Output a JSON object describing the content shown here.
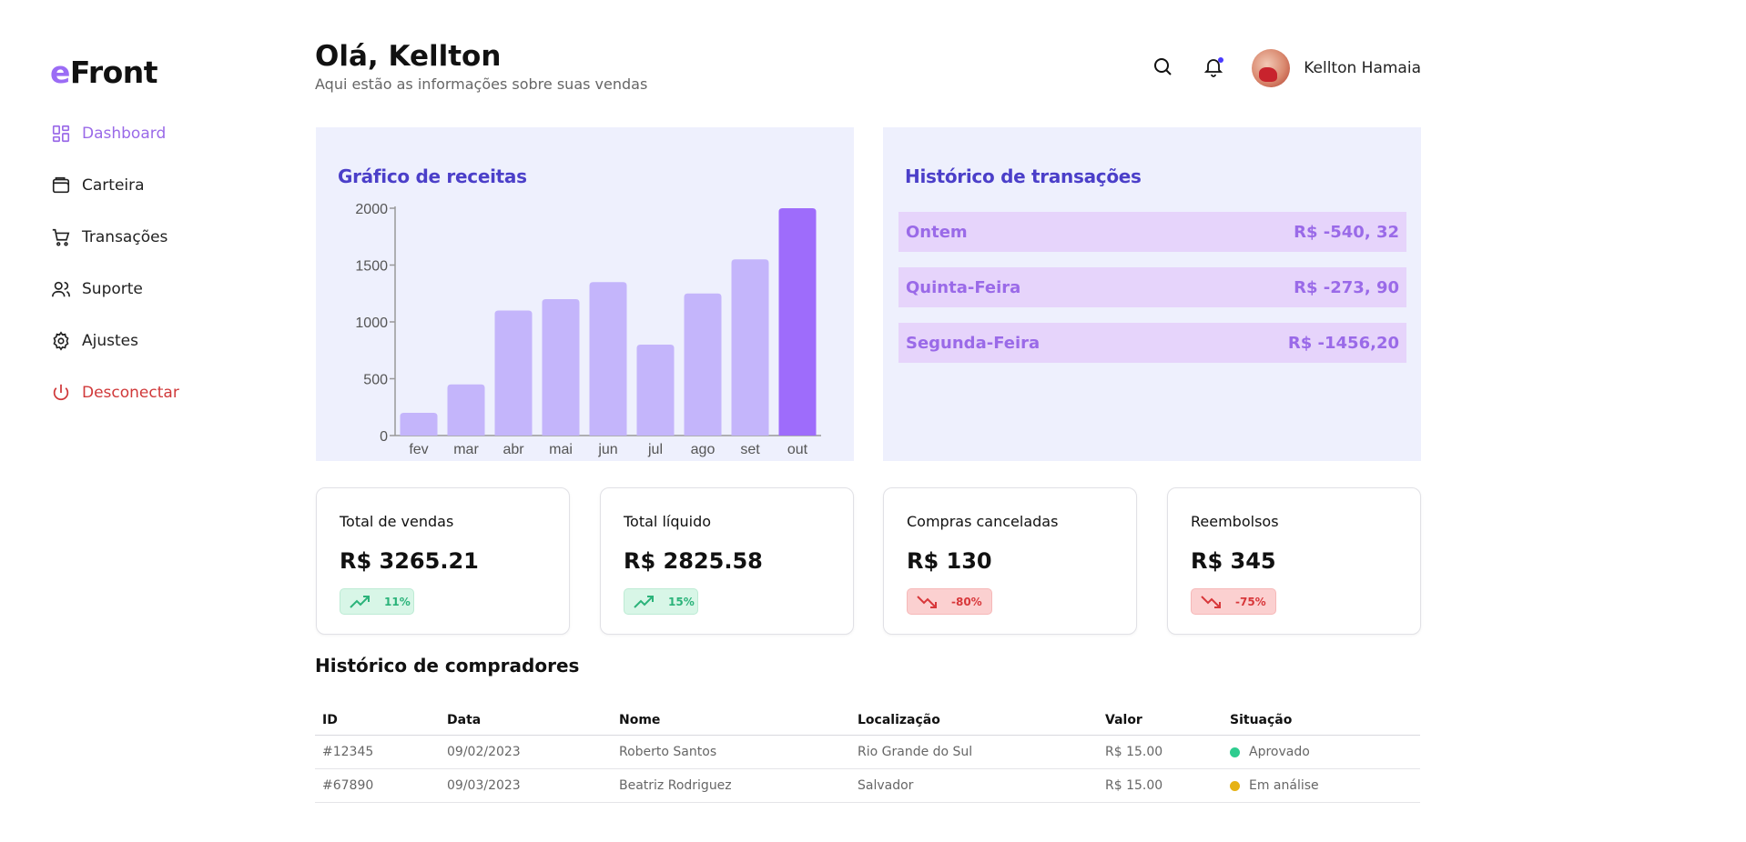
{
  "brand": {
    "prefix": "e",
    "name": "Front",
    "accent_color": "#9b6cf5"
  },
  "sidebar": {
    "items": [
      {
        "label": "Dashboard",
        "icon": "dashboard-icon",
        "state": "active"
      },
      {
        "label": "Carteira",
        "icon": "wallet-icon",
        "state": "normal"
      },
      {
        "label": "Transações",
        "icon": "cart-icon",
        "state": "normal"
      },
      {
        "label": "Suporte",
        "icon": "users-icon",
        "state": "normal"
      },
      {
        "label": "Ajustes",
        "icon": "gear-icon",
        "state": "normal"
      },
      {
        "label": "Desconectar",
        "icon": "power-icon",
        "state": "danger"
      }
    ]
  },
  "header": {
    "greeting": "Olá, Kellton",
    "subtitle": "Aqui estão as informações sobre suas vendas",
    "user_name": "Kellton Hamaia"
  },
  "revenue_panel": {
    "title": "Gráfico de receitas"
  },
  "chart_data": {
    "type": "bar",
    "categories": [
      "fev",
      "mar",
      "abr",
      "mai",
      "jun",
      "jul",
      "ago",
      "set",
      "out"
    ],
    "values": [
      200,
      450,
      1100,
      1200,
      1350,
      800,
      1250,
      1550,
      2000
    ],
    "highlight_index": 8,
    "bar_color": "#c4b5fb",
    "highlight_color": "#9e6cfb",
    "ylim": [
      0,
      2000
    ],
    "yticks": [
      "0",
      "500",
      "1000",
      "1500",
      "2000"
    ],
    "title": "Gráfico de receitas",
    "xlabel": "",
    "ylabel": "",
    "grid": false
  },
  "transactions": {
    "title": "Histórico de transações",
    "rows": [
      {
        "label": "Ontem",
        "amount": "R$ -540, 32"
      },
      {
        "label": "Quinta-Feira",
        "amount": "R$ -273, 90"
      },
      {
        "label": "Segunda-Feira",
        "amount": "R$ -1456,20"
      }
    ]
  },
  "cards": [
    {
      "title": "Total de vendas",
      "value": "R$ 3265.21",
      "change": "11%",
      "trend": "up"
    },
    {
      "title": "Total líquido",
      "value": "R$ 2825.58",
      "change": "15%",
      "trend": "up"
    },
    {
      "title": "Compras canceladas",
      "value": "R$ 130",
      "change": "-80%",
      "trend": "down"
    },
    {
      "title": "Reembolsos",
      "value": "R$ 345",
      "change": "-75%",
      "trend": "down"
    }
  ],
  "buyers": {
    "title": "Histórico de compradores",
    "columns": [
      "ID",
      "Data",
      "Nome",
      "Localização",
      "Valor",
      "Situação"
    ],
    "rows": [
      {
        "id": "#12345",
        "date": "09/02/2023",
        "name": "Roberto Santos",
        "location": "Rio Grande do Sul",
        "value": "R$ 15.00",
        "status": "Aprovado",
        "status_color": "#2ecc8f"
      },
      {
        "id": "#67890",
        "date": "09/03/2023",
        "name": "Beatriz Rodriguez",
        "location": "Salvador",
        "value": "R$ 15.00",
        "status": "Em análise",
        "status_color": "#e6b214"
      }
    ]
  }
}
